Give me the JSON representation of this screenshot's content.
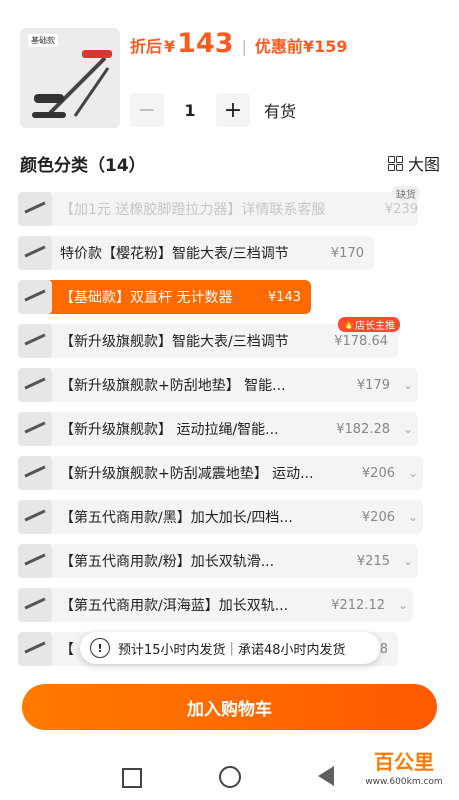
{
  "header": {
    "discount_label": "折后",
    "currency": "¥",
    "discount_price": "143",
    "separator": "|",
    "original_label": "优惠前",
    "original_price": "¥159",
    "product_tag": "基础款"
  },
  "stepper": {
    "minus": "−",
    "plus": "+",
    "quantity": "1",
    "stock": "有货"
  },
  "section": {
    "title": "颜色分类（14）",
    "view_label": "大图"
  },
  "options": [
    {
      "label": "【加1元 送橡胶脚蹬拉力器】详情联系客服",
      "price": "¥239",
      "badge": "缺货"
    },
    {
      "label": "特价款【樱花粉】智能大表/三档调节",
      "price": "¥170",
      "badge": ""
    },
    {
      "label": "【基础款】双直杆 无计数器",
      "price": "¥143",
      "badge": ""
    },
    {
      "label": "【新升级旗舰款】智能大表/三档调节",
      "price": "¥178.64",
      "badge": "店长主推"
    },
    {
      "label": "【新升级旗舰款+防刮地垫】 智能...",
      "price": "¥179",
      "badge": ""
    },
    {
      "label": "【新升级旗舰款】 运动拉绳/智能...",
      "price": "¥182.28",
      "badge": ""
    },
    {
      "label": "【新升级旗舰款+防刮减震地垫】 运动...",
      "price": "¥206",
      "badge": ""
    },
    {
      "label": "【第五代商用款/黑】加大加长/四档...",
      "price": "¥206",
      "badge": ""
    },
    {
      "label": "【第五代商用款/粉】加长双轨滑...",
      "price": "¥215",
      "badge": ""
    },
    {
      "label": "【第五代商用款/洱海蓝】加长双轨...",
      "price": "¥212.12",
      "badge": ""
    },
    {
      "label": "【",
      "price": "8",
      "badge": ""
    }
  ],
  "toast": {
    "icon": "!",
    "text1": "预计15小时内发货",
    "pipe": "|",
    "text2": "承诺48小时内发货"
  },
  "cart_button": "加入购物车",
  "watermark": {
    "brand": "百公里",
    "url": "www.600km.com"
  },
  "colors": {
    "accent": "#ff6a00",
    "price": "#ff5a1f"
  }
}
